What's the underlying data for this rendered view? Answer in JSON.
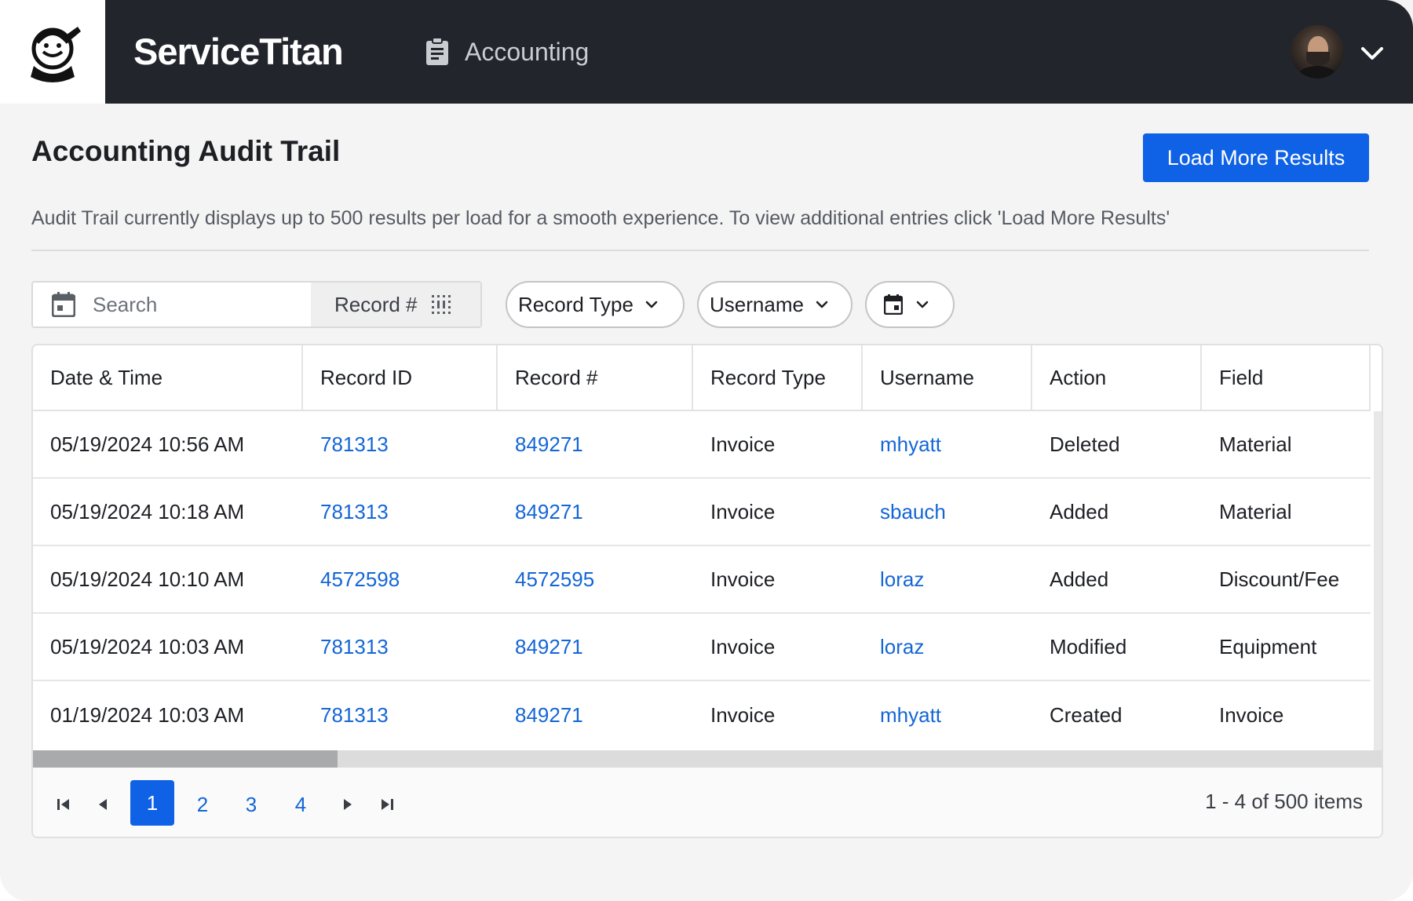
{
  "app": {
    "brand": "ServiceTitan",
    "nav_item": "Accounting"
  },
  "page": {
    "title": "Accounting Audit Trail",
    "load_more_label": "Load More Results",
    "description": "Audit Trail currently displays up to 500 results per load for a smooth experience. To view additional entries click 'Load More Results'"
  },
  "filters": {
    "search_placeholder": "Search",
    "search_scope": "Record #",
    "record_type": "Record Type",
    "username": "Username"
  },
  "table": {
    "headers": [
      "Date & Time",
      "Record ID",
      "Record #",
      "Record Type",
      "Username",
      "Action",
      "Field"
    ],
    "rows": [
      [
        "05/19/2024 10:56 AM",
        "781313",
        "849271",
        "Invoice",
        "mhyatt",
        "Deleted",
        "Material"
      ],
      [
        "05/19/2024 10:18 AM",
        "781313",
        "849271",
        "Invoice",
        "sbauch",
        "Added",
        "Material"
      ],
      [
        "05/19/2024 10:10 AM",
        "4572598",
        "4572595",
        "Invoice",
        "loraz",
        "Added",
        "Discount/Fee"
      ],
      [
        "05/19/2024 10:03 AM",
        "781313",
        "849271",
        "Invoice",
        "loraz",
        "Modified",
        "Equipment"
      ],
      [
        "01/19/2024 10:03 AM",
        "781313",
        "849271",
        "Invoice",
        "mhyatt",
        "Created",
        "Invoice"
      ]
    ]
  },
  "pagination": {
    "pages": [
      "1",
      "2",
      "3",
      "4"
    ],
    "summary": "1 - 4 of 500 items"
  },
  "colors": {
    "topbar": "#22262c",
    "primary": "#0f62e6",
    "link": "#1466d6"
  }
}
